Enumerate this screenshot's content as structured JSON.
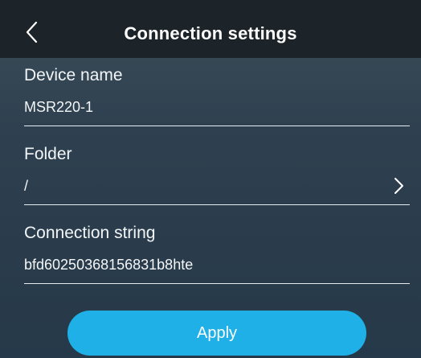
{
  "header": {
    "title": "Connection settings"
  },
  "fields": {
    "device_name": {
      "label": "Device name",
      "value": "MSR220-1"
    },
    "folder": {
      "label": "Folder",
      "value": "/"
    },
    "connection_string": {
      "label": "Connection string",
      "value": "bfd60250368156831b8hte"
    }
  },
  "actions": {
    "apply_label": "Apply"
  },
  "colors": {
    "header_bg": "#1d2429",
    "page_bg": "#2f4150",
    "accent": "#1eb0e6",
    "underline": "#e6ebef"
  },
  "icons": {
    "back": "chevron-left-icon",
    "folder_open": "chevron-right-icon"
  }
}
